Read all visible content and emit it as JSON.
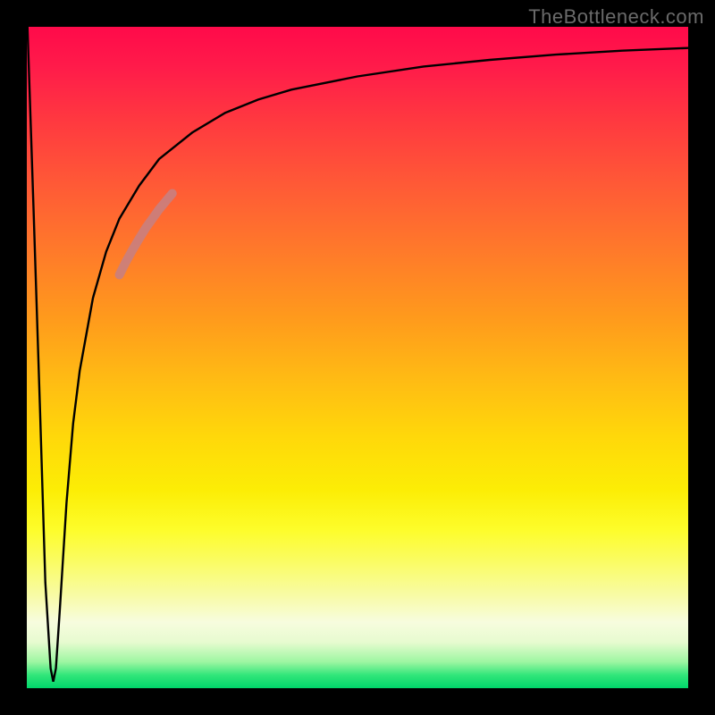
{
  "watermark": "TheBottleneck.com",
  "chart_data": {
    "type": "line",
    "title": "",
    "xlabel": "",
    "ylabel": "",
    "xlim": [
      0,
      100
    ],
    "ylim": [
      0,
      100
    ],
    "grid": false,
    "legend": false,
    "background_gradient_stops": [
      {
        "pos": 0,
        "color": "#ff0a4a"
      },
      {
        "pos": 50,
        "color": "#ffba14"
      },
      {
        "pos": 80,
        "color": "#fdfd2a"
      },
      {
        "pos": 100,
        "color": "#00d66a"
      }
    ],
    "series": [
      {
        "name": "bottleneck-curve",
        "color": "#000000",
        "x": [
          0.1,
          1.0,
          2.0,
          2.8,
          3.6,
          4.0,
          4.4,
          5.0,
          6.0,
          7.0,
          8.0,
          10.0,
          12.0,
          14.0,
          17.0,
          20.0,
          25.0,
          30.0,
          35.0,
          40.0,
          50.0,
          60.0,
          70.0,
          80.0,
          90.0,
          100.0
        ],
        "y": [
          100.0,
          73.0,
          42.0,
          16.0,
          3.0,
          1.0,
          3.0,
          12.0,
          28.0,
          40.0,
          48.0,
          59.0,
          66.0,
          71.0,
          76.0,
          80.0,
          84.0,
          87.0,
          89.0,
          90.5,
          92.5,
          94.0,
          95.0,
          95.8,
          96.4,
          96.8
        ]
      },
      {
        "name": "highlight-segment",
        "color": "#c98080",
        "x": [
          14.0,
          15.0,
          16.0,
          17.0,
          18.0,
          19.0,
          20.0,
          21.0,
          22.0
        ],
        "y": [
          62.5,
          64.5,
          66.3,
          68.0,
          69.6,
          71.0,
          72.4,
          73.6,
          74.8
        ]
      }
    ],
    "annotations": []
  }
}
